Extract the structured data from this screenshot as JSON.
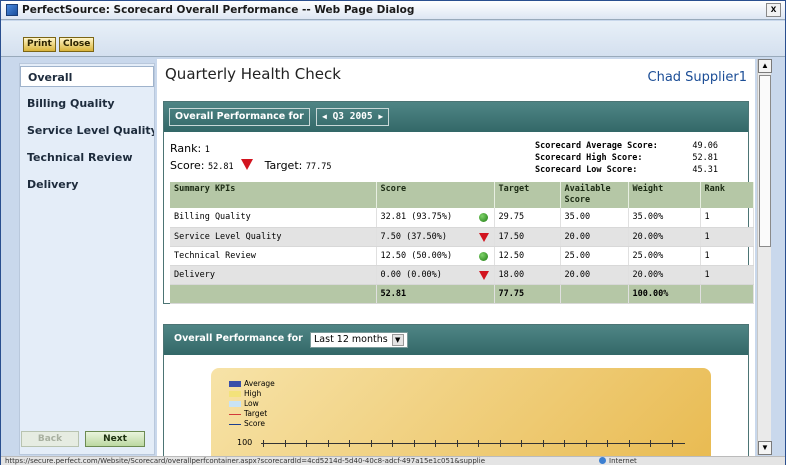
{
  "window": {
    "title": "PerfectSource: Scorecard Overall Performance -- Web Page Dialog",
    "close_label": "x"
  },
  "toolbar": {
    "print_label": "Print",
    "close_label": "Close"
  },
  "sidebar": {
    "items": [
      {
        "label": "Overall",
        "active": true
      },
      {
        "label": "Billing Quality"
      },
      {
        "label": "Service Level Quality"
      },
      {
        "label": "Technical Review"
      },
      {
        "label": "Delivery"
      }
    ],
    "back_label": "Back",
    "next_label": "Next"
  },
  "header": {
    "title": "Quarterly Health Check",
    "user": "Chad Supplier1"
  },
  "overall": {
    "heading": "Overall Performance for",
    "quarter": "Q3 2005",
    "rank_label": "Rank:",
    "rank_value": "1",
    "score_label": "Score:",
    "score_value": "52.81",
    "target_label": "Target:",
    "target_value": "77.75",
    "avg_label": "Scorecard Average Score:",
    "avg_value": "49.06",
    "high_label": "Scorecard High Score:",
    "high_value": "52.81",
    "low_label": "Scorecard Low Score:",
    "low_value": "45.31"
  },
  "table": {
    "headers": [
      "Summary KPIs",
      "Score",
      "Target",
      "Available Score",
      "Weight",
      "Rank"
    ],
    "rows": [
      {
        "kpi": "Billing Quality",
        "score": "32.81 (93.75%)",
        "status": "green",
        "target": "29.75",
        "available": "35.00",
        "weight": "35.00%",
        "rank": "1"
      },
      {
        "kpi": "Service Level Quality",
        "score": "7.50 (37.50%)",
        "status": "red",
        "target": "17.50",
        "available": "20.00",
        "weight": "20.00%",
        "rank": "1"
      },
      {
        "kpi": "Technical Review",
        "score": "12.50 (50.00%)",
        "status": "green",
        "target": "12.50",
        "available": "25.00",
        "weight": "25.00%",
        "rank": "1"
      },
      {
        "kpi": "Delivery",
        "score": "0.00 (0.00%)",
        "status": "red",
        "target": "18.00",
        "available": "20.00",
        "weight": "20.00%",
        "rank": "1"
      }
    ],
    "totals": {
      "score": "52.81",
      "target": "77.75",
      "weight": "100.00%"
    }
  },
  "trend": {
    "heading": "Overall Performance for",
    "period": "Last 12 months",
    "legend": [
      {
        "label": "Average",
        "color": "#3a4fa8"
      },
      {
        "label": "High",
        "color": "#f3e27a"
      },
      {
        "label": "Low",
        "color": "#c9e3f5"
      },
      {
        "label": "Target",
        "color": "#d23a3a"
      },
      {
        "label": "Score",
        "color": "#1c3f8f"
      }
    ],
    "axis_label": "100"
  },
  "statusbar": {
    "url": "https://secure.perfect.com/Website/Scorecard/overallperfcontainer.aspx?scorecardId=4cd5214d-5d40-40c8-adcf-497a15e1c051&supplie",
    "zone": "Internet"
  }
}
